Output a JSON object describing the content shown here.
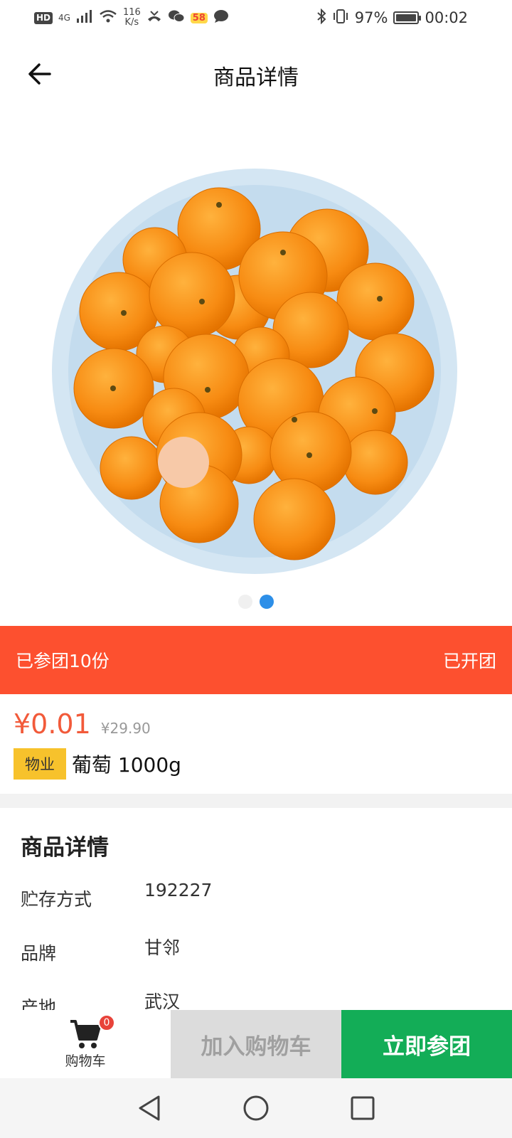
{
  "status_bar": {
    "hd": "HD",
    "network": "4G",
    "speed_value": "116",
    "speed_unit": "K/s",
    "app_badge": "58",
    "battery": "97%",
    "time": "00:02"
  },
  "header": {
    "title": "商品详情"
  },
  "carousel": {
    "slide_count": 2,
    "active_index": 1
  },
  "group_banner": {
    "joined_text": "已参团10份",
    "status_text": "已开团",
    "color": "#fd502f"
  },
  "price": {
    "current": "¥0.01",
    "original": "¥29.90",
    "color": "#f25a3a"
  },
  "product": {
    "tag": "物业",
    "name": "葡萄 1000g"
  },
  "details": {
    "section_title": "商品详情",
    "specs": [
      {
        "label": "贮存方式",
        "value": "192227"
      },
      {
        "label": "品牌",
        "value": "甘邻"
      },
      {
        "label": "产地",
        "value": "武汉"
      }
    ]
  },
  "action_bar": {
    "cart_label": "购物车",
    "cart_count": "0",
    "add_to_cart": "加入购物车",
    "join_group": "立即参团"
  },
  "icons": [
    "back-arrow-icon",
    "cart-icon",
    "nav-back-icon",
    "nav-home-icon",
    "nav-recents-icon"
  ]
}
